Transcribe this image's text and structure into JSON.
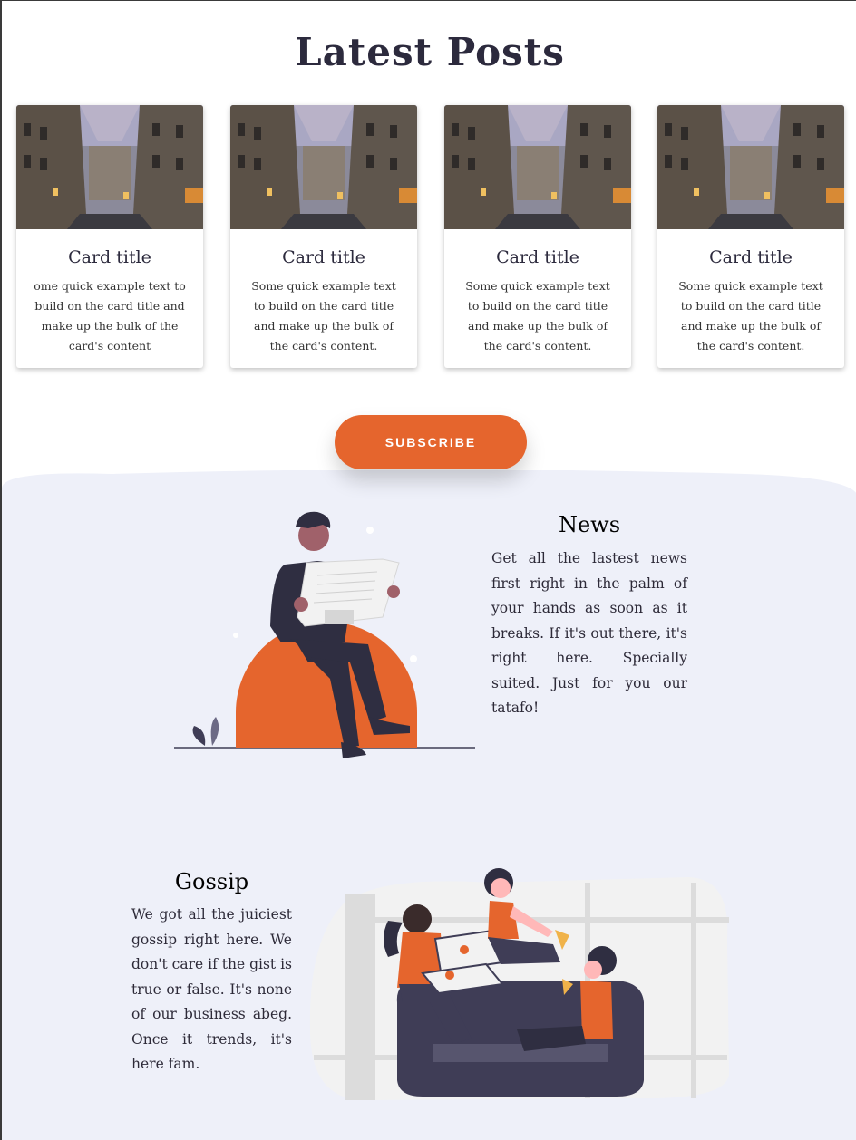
{
  "page": {
    "title": "Latest Posts"
  },
  "cards": [
    {
      "title": "Card title",
      "text": "ome quick example text to build on the card title and make up the bulk of the card's content"
    },
    {
      "title": "Card title",
      "text": "Some quick example text to build on the card title and make up the bulk of the card's content."
    },
    {
      "title": "Card title",
      "text": "Some quick example text to build on the card title and make up the bulk of the card's content."
    },
    {
      "title": "Card title",
      "text": "Some quick example text to build on the card title and make up the bulk of the card's content."
    }
  ],
  "subscribe": {
    "label": "SUBSCRIBE"
  },
  "news": {
    "title": "News",
    "text": "Get all the lastest news first right in the palm of your hands as soon as it breaks. If it's out there, it's right here. Specially suited. Just for you our tatafo!"
  },
  "gossip": {
    "title": "Gossip",
    "text": "We got all the juiciest gossip right here. We don't care if the gist is true or false. It's none of our business abeg. Once it trends, it's here fam."
  },
  "colors": {
    "accent": "#e5652d",
    "section_bg": "#eef0f9",
    "dark": "#2f2e41"
  }
}
